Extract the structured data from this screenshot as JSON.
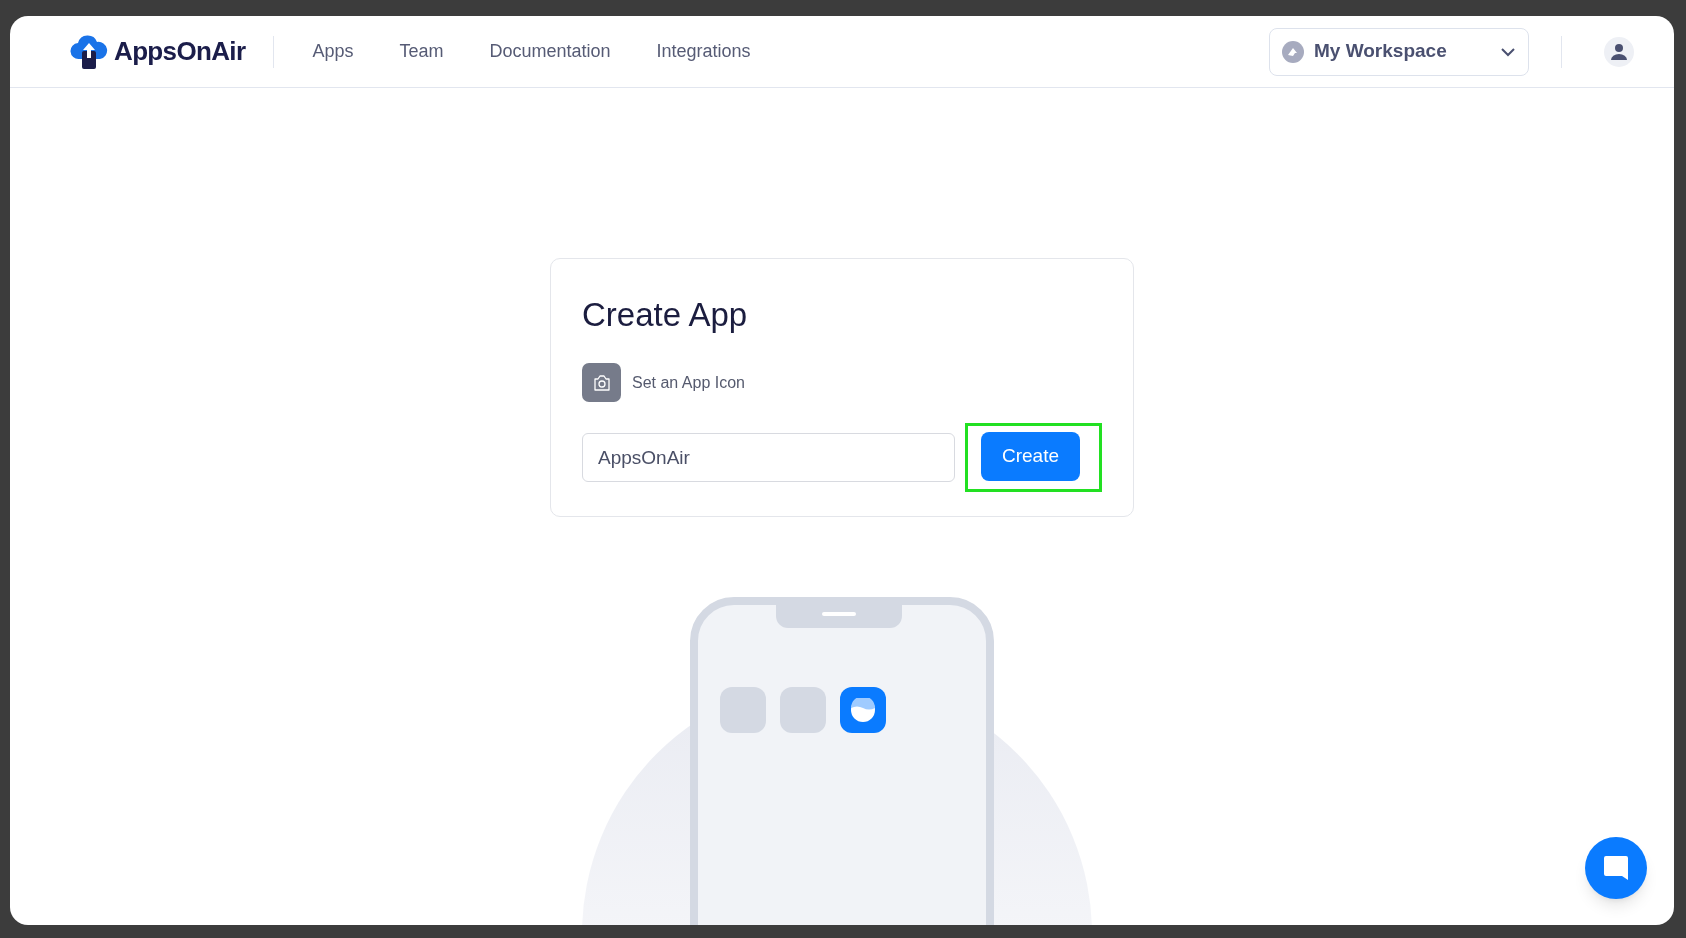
{
  "header": {
    "brand": "AppsOnAir",
    "nav": [
      {
        "label": "Apps",
        "selected": false
      },
      {
        "label": "Team",
        "selected": false
      },
      {
        "label": "Documentation",
        "selected": false
      },
      {
        "label": "Integrations",
        "selected": false
      }
    ],
    "workspace": "My Workspace"
  },
  "form": {
    "title": "Create App",
    "icon_label": "Set an App Icon",
    "name_value": "AppsOnAir",
    "submit": "Create"
  }
}
